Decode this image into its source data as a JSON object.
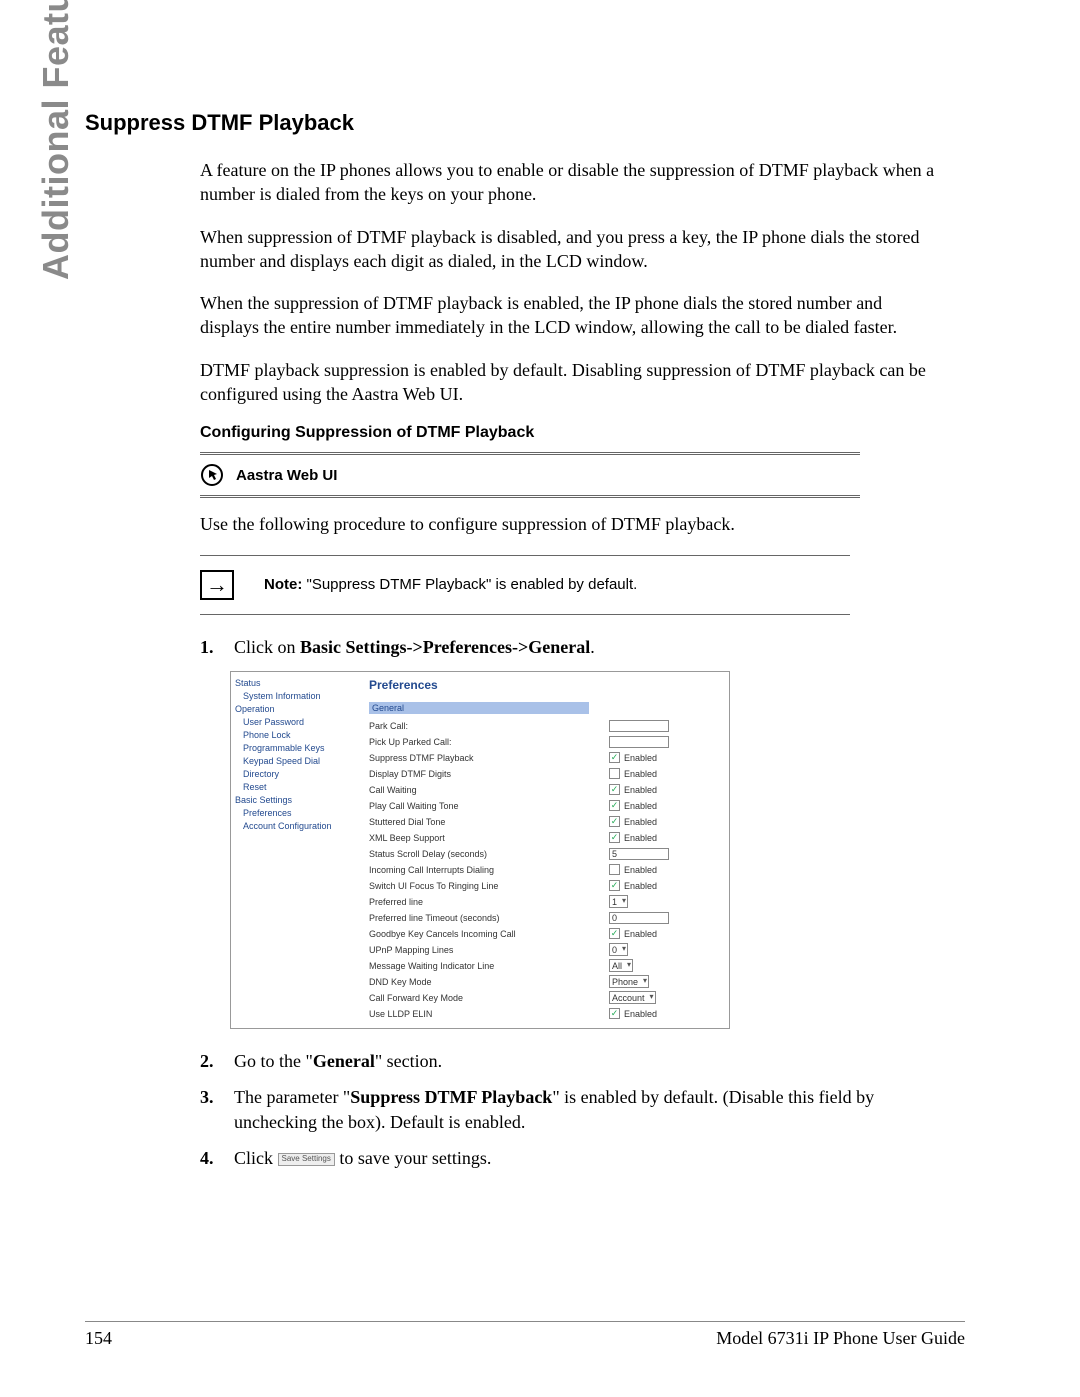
{
  "sidebar_label": "Additional Features",
  "title": "Suppress DTMF Playback",
  "paragraphs": {
    "p1": "A feature on the IP phones allows you to enable or disable the suppression of DTMF playback when a number is dialed from the keys on your phone.",
    "p2": "When suppression of DTMF playback is disabled, and you press a key, the IP phone dials the stored number and displays each digit as dialed, in the LCD window.",
    "p3": "When the suppression of DTMF playback is enabled, the IP phone dials the stored number and displays the entire number immediately in the LCD window, allowing the call to be dialed faster.",
    "p4": "DTMF playback suppression is enabled by default. Disabling suppression of DTMF playback can be configured using the Aastra Web UI."
  },
  "subheading": "Configuring Suppression of DTMF Playback",
  "callout_label": "Aastra Web UI",
  "lead": "Use the following procedure to configure suppression of DTMF playback.",
  "note": {
    "label": "Note:",
    "text": " \"Suppress DTMF Playback\" is enabled by default."
  },
  "steps": {
    "s1_a": "Click on ",
    "s1_b": "Basic Settings->Preferences->General",
    "s1_c": ".",
    "s2_a": "Go to the \"",
    "s2_b": "General",
    "s2_c": "\" section.",
    "s3_a": "The parameter \"",
    "s3_b": "Suppress DTMF Playback",
    "s3_c": "\" is enabled by default. (Disable this field by unchecking the box). Default is enabled.",
    "s4_a": "Click ",
    "s4_btn": "Save Settings",
    "s4_b": " to save your settings."
  },
  "ui": {
    "nav": {
      "status": "Status",
      "sysinfo": "System Information",
      "operation": "Operation",
      "userpw": "User Password",
      "phonelock": "Phone Lock",
      "progkeys": "Programmable Keys",
      "keypad": "Keypad Speed Dial",
      "directory": "Directory",
      "reset": "Reset",
      "basic": "Basic Settings",
      "prefs": "Preferences",
      "acct": "Account Configuration"
    },
    "main": {
      "title": "Preferences",
      "section": "General",
      "rows": [
        {
          "label": "Park Call:",
          "type": "text",
          "value": ""
        },
        {
          "label": "Pick Up Parked Call:",
          "type": "text",
          "value": ""
        },
        {
          "label": "Suppress DTMF Playback",
          "type": "check",
          "checked": true,
          "checklabel": "Enabled"
        },
        {
          "label": "Display DTMF Digits",
          "type": "check",
          "checked": false,
          "checklabel": "Enabled"
        },
        {
          "label": "Call Waiting",
          "type": "check",
          "checked": true,
          "checklabel": "Enabled"
        },
        {
          "label": "Play Call Waiting Tone",
          "type": "check",
          "checked": true,
          "checklabel": "Enabled"
        },
        {
          "label": "Stuttered Dial Tone",
          "type": "check",
          "checked": true,
          "checklabel": "Enabled"
        },
        {
          "label": "XML Beep Support",
          "type": "check",
          "checked": true,
          "checklabel": "Enabled"
        },
        {
          "label": "Status Scroll Delay (seconds)",
          "type": "text",
          "value": "5"
        },
        {
          "label": "Incoming Call Interrupts Dialing",
          "type": "check",
          "checked": false,
          "checklabel": "Enabled"
        },
        {
          "label": "Switch UI Focus To Ringing Line",
          "type": "check",
          "checked": true,
          "checklabel": "Enabled"
        },
        {
          "label": "Preferred line",
          "type": "select",
          "value": "1"
        },
        {
          "label": "Preferred line Timeout (seconds)",
          "type": "text",
          "value": "0"
        },
        {
          "label": "Goodbye Key Cancels Incoming Call",
          "type": "check",
          "checked": true,
          "checklabel": "Enabled"
        },
        {
          "label": "UPnP Mapping Lines",
          "type": "select",
          "value": "0"
        },
        {
          "label": "Message Waiting Indicator Line",
          "type": "select",
          "value": "All"
        },
        {
          "label": "DND Key Mode",
          "type": "select",
          "value": "Phone"
        },
        {
          "label": "Call Forward Key Mode",
          "type": "select",
          "value": "Account"
        },
        {
          "label": "Use LLDP ELIN",
          "type": "check",
          "checked": true,
          "checklabel": "Enabled"
        }
      ]
    }
  },
  "footer": {
    "page": "154",
    "doc": "Model 6731i IP Phone User Guide"
  }
}
